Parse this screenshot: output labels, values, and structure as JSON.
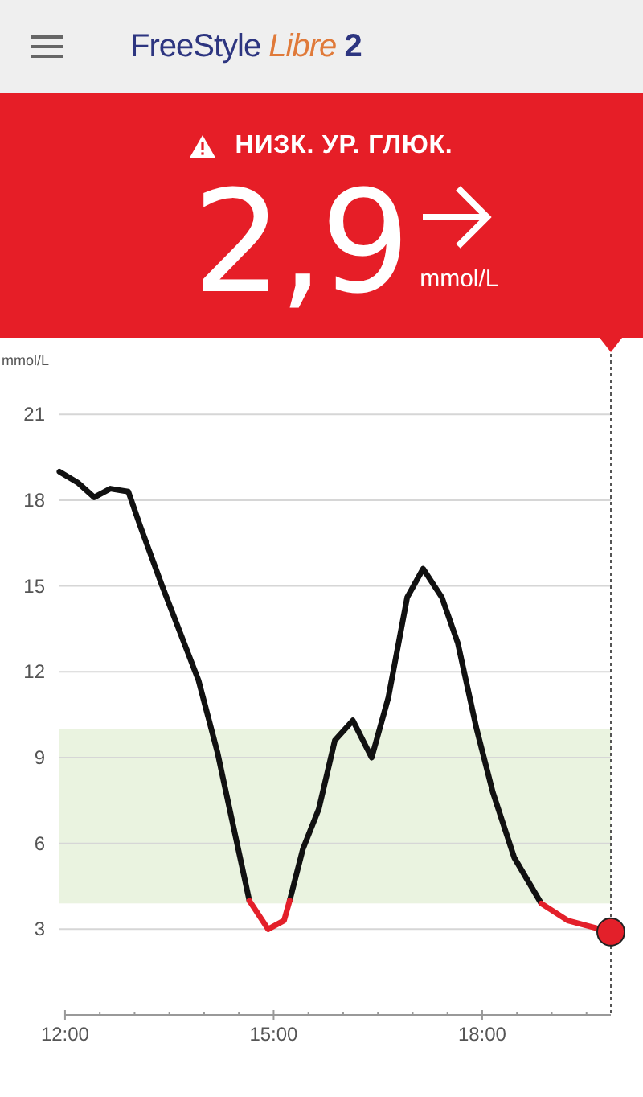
{
  "header": {
    "logo": {
      "brand": "FreeStyle",
      "product": "Libre",
      "version": "2"
    }
  },
  "reading": {
    "alert": "НИЗК. УР. ГЛЮК.",
    "value": "2,9",
    "unit": "mmol/L"
  },
  "chart": {
    "chart_data": {
      "type": "line",
      "ylabel": "mmol/L",
      "x": [
        11.92,
        12.19,
        12.42,
        12.65,
        12.91,
        13.08,
        13.38,
        13.92,
        14.19,
        14.65,
        14.92,
        15.15,
        15.23,
        15.42,
        15.65,
        15.88,
        16.14,
        16.41,
        16.65,
        16.92,
        17.15,
        17.42,
        17.65,
        17.92,
        18.15,
        18.46,
        18.85,
        19.23,
        19.85
      ],
      "series": [
        {
          "color": "#111111",
          "values": [
            19.0,
            18.6,
            18.1,
            18.4,
            18.3,
            17.1,
            15.1,
            11.7,
            9.2,
            4.0,
            null,
            null,
            4.0,
            5.8,
            7.2,
            9.6,
            10.3,
            9.0,
            11.1,
            14.6,
            15.6,
            14.6,
            13.0,
            10.0,
            7.8,
            5.5,
            3.9,
            null,
            null
          ]
        },
        {
          "color": "#e3202a",
          "values": [
            null,
            null,
            null,
            null,
            null,
            null,
            null,
            null,
            null,
            4.0,
            3.0,
            3.3,
            4.0,
            null,
            null,
            null,
            null,
            null,
            null,
            null,
            null,
            null,
            null,
            null,
            null,
            null,
            3.9,
            3.3,
            2.9
          ]
        }
      ],
      "xlim": [
        11.92,
        19.85
      ],
      "ylim": [
        0,
        21
      ],
      "xticks": [
        {
          "value": 12,
          "label": "12:00"
        },
        {
          "value": 15,
          "label": "15:00"
        },
        {
          "value": 18,
          "label": "18:00"
        }
      ],
      "yticks": [
        3,
        6,
        9,
        12,
        15,
        18,
        21
      ],
      "grid": true,
      "bands": [
        {
          "axis": "y",
          "from": 3.9,
          "to": 10,
          "color": "#eaf3e0"
        }
      ]
    }
  }
}
